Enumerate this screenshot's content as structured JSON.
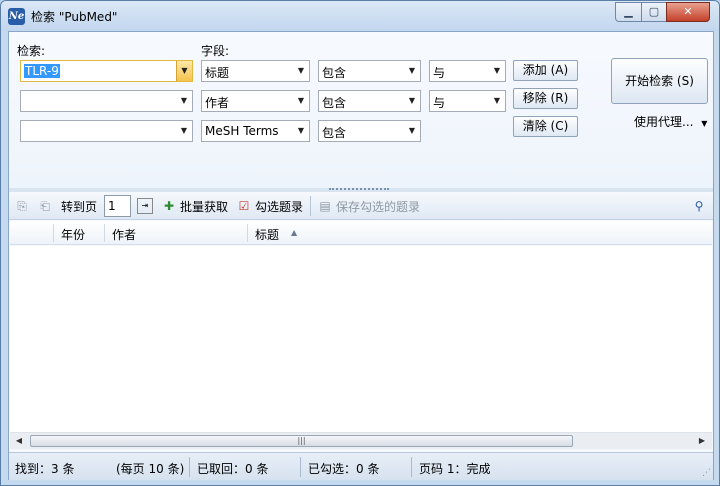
{
  "window": {
    "title": "检索 \"PubMed\"",
    "app_icon_text": "Ne"
  },
  "search": {
    "query_label": "检索:",
    "field_label": "字段:",
    "rows": [
      {
        "term": "TLR-9",
        "field": "标题",
        "condition": "包含",
        "bool": "与",
        "button": "添加 (A)"
      },
      {
        "term": "",
        "field": "作者",
        "condition": "包含",
        "bool": "与",
        "button": "移除 (R)"
      },
      {
        "term": "",
        "field": "MeSH Terms",
        "condition": "包含",
        "button": "清除 (C)"
      }
    ],
    "start_button": "开始检索 (S)",
    "proxy_label": "使用代理..."
  },
  "toolbar": {
    "goto_page_label": "转到页",
    "page_value": "1",
    "batch_fetch_label": "批量获取",
    "check_records_label": "勾选题录",
    "save_checked_label": "保存勾选的题录"
  },
  "grid": {
    "columns": [
      "年份",
      "作者",
      "标题"
    ]
  },
  "status": {
    "found": "找到：3 条",
    "per_page": "(每页 10 条)",
    "fetched": "已取回：0 条",
    "checked": "已勾选：0 条",
    "page_status": "页码 1：完成"
  }
}
